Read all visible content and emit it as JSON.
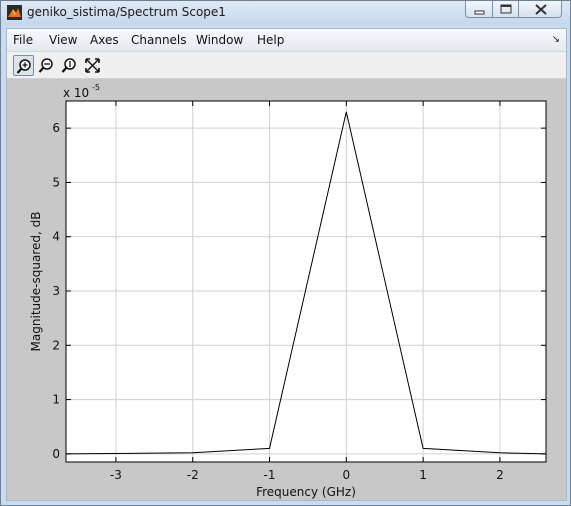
{
  "window": {
    "title": "geniko_sistima/Spectrum Scope1",
    "colors": {
      "titlebar": "#c5d7ec",
      "plot_bg": "#c8c8c8",
      "axes_bg": "#ffffff",
      "line": "#000000"
    }
  },
  "menubar": {
    "items": [
      "File",
      "View",
      "Axes",
      "Channels",
      "Window",
      "Help"
    ],
    "dock_icon": "dock-arrow-icon"
  },
  "toolbar": {
    "tools": [
      {
        "icon": "zoom-in-icon",
        "active": true
      },
      {
        "icon": "zoom-x-icon",
        "active": false
      },
      {
        "icon": "zoom-y-icon",
        "active": false
      },
      {
        "icon": "autoscale-icon",
        "active": false
      }
    ]
  },
  "chart_data": {
    "type": "line",
    "xlabel": "Frequency (GHz)",
    "ylabel": "Magnitude-squared, dB",
    "y_exponent_label": "x 10",
    "y_exponent": "-5",
    "xlim": [
      -3.65,
      2.6
    ],
    "ylim": [
      -0.15,
      6.5
    ],
    "xticks": [
      -3,
      -2,
      -1,
      0,
      1,
      2
    ],
    "yticks": [
      0,
      1,
      2,
      3,
      4,
      5,
      6
    ],
    "grid": true,
    "series": [
      {
        "x": [
          -3.65,
          -2.0,
          -1.0,
          0.0,
          1.0,
          2.0,
          2.6
        ],
        "y": [
          0.0,
          0.02,
          0.1,
          6.3,
          0.1,
          0.02,
          0.0
        ]
      }
    ]
  }
}
